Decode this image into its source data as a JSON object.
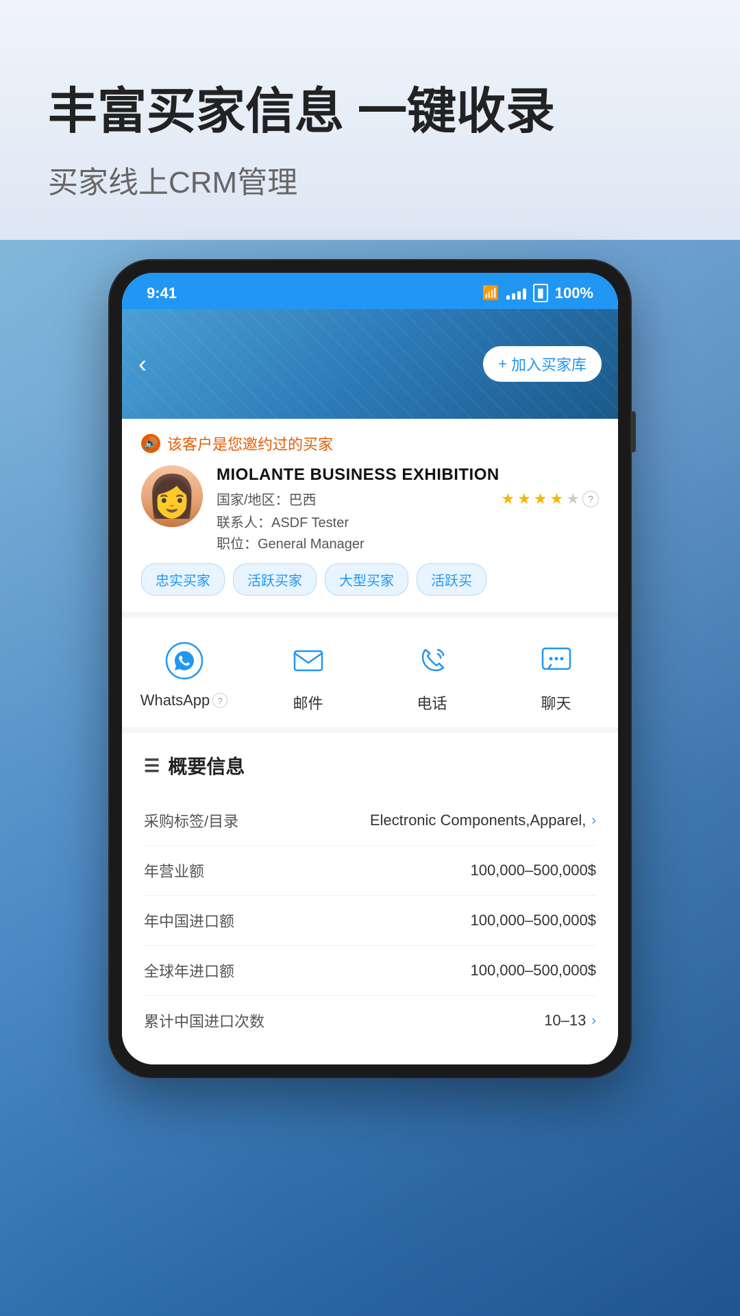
{
  "hero": {
    "title": "丰富买家信息 一键收录",
    "subtitle": "买家线上CRM管理"
  },
  "statusBar": {
    "time": "9:41",
    "battery": "100%"
  },
  "phoneHeader": {
    "backLabel": "‹",
    "addButtonIcon": "+",
    "addButtonLabel": "加入买家库"
  },
  "customerCard": {
    "notice": "该客户是您邀约过的买家",
    "companyName": "MIOLANTE BUSINESS EXHIBITION",
    "country": "国家/地区：巴西",
    "contact": "联系人：ASDF Tester",
    "position": "职位：General Manager",
    "stars": 4,
    "totalStars": 5,
    "tags": [
      "忠实买家",
      "活跃买家",
      "大型买家",
      "活跃买"
    ]
  },
  "actions": [
    {
      "id": "whatsapp",
      "label": "WhatsApp",
      "hasHelp": true
    },
    {
      "id": "mail",
      "label": "邮件",
      "hasHelp": false
    },
    {
      "id": "phone",
      "label": "电话",
      "hasHelp": false
    },
    {
      "id": "chat",
      "label": "聊天",
      "hasHelp": false
    }
  ],
  "infoSection": {
    "title": "概要信息",
    "rows": [
      {
        "key": "采购标签/目录",
        "value": "Electronic Components,Apparel,",
        "hasChevron": true
      },
      {
        "key": "年营业额",
        "value": "100,000–500,000$",
        "hasChevron": false
      },
      {
        "key": "年中国进口额",
        "value": "100,000–500,000$",
        "hasChevron": false
      },
      {
        "key": "全球年进口额",
        "value": "100,000–500,000$",
        "hasChevron": false
      },
      {
        "key": "累计中国进口次数",
        "value": "10–13",
        "hasChevron": true
      }
    ]
  }
}
